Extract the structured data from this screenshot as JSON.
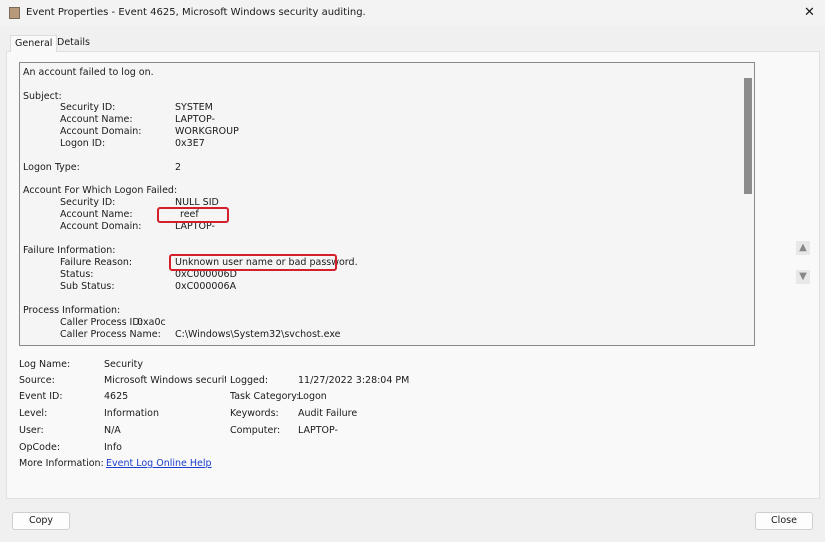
{
  "window": {
    "title": "Event Properties - Event 4625, Microsoft Windows security auditing.",
    "close": "✕"
  },
  "tabs": [
    {
      "label": "General"
    },
    {
      "label": "Details"
    }
  ],
  "description": [
    {
      "text": "An account failed to log on.",
      "indent": 0
    },
    {
      "text": "Subject:",
      "indent": 0
    },
    {
      "label": "Security ID:",
      "value": "SYSTEM"
    },
    {
      "label": "Account Name:",
      "value": "LAPTOP-"
    },
    {
      "label": "Account Domain:",
      "value": "WORKGROUP"
    },
    {
      "label": "Logon ID:",
      "value": "0x3E7"
    },
    {
      "label0": "Logon Type:",
      "value": "2"
    },
    {
      "text": "Account For Which Logon Failed:"
    },
    {
      "label": "Security ID:",
      "value": "NULL SID"
    },
    {
      "label": "Account Name:",
      "value": "reef"
    },
    {
      "label": "Account Domain:",
      "value": "LAPTOP-"
    },
    {
      "text": "Failure Information:"
    },
    {
      "label": "Failure Reason:",
      "value": "Unknown user name or bad password."
    },
    {
      "label": "Status:",
      "value": "0xC000006D"
    },
    {
      "label": "Sub Status:",
      "value": "0xC000006A"
    },
    {
      "text": "Process Information:"
    },
    {
      "label": "Caller Process ID:",
      "value": "0xa0c"
    },
    {
      "label": "Caller Process Name:",
      "value": "C:\\Windows\\System32\\svchost.exe"
    }
  ],
  "fields": {
    "log_name": {
      "label": "Log Name:",
      "value": "Security"
    },
    "source": {
      "label": "Source:",
      "value": "Microsoft Windows security :"
    },
    "event_id": {
      "label": "Event ID:",
      "value": "4625"
    },
    "level": {
      "label": "Level:",
      "value": "Information"
    },
    "user": {
      "label": "User:",
      "value": "N/A"
    },
    "opcode": {
      "label": "OpCode:",
      "value": "Info"
    },
    "more_info": {
      "label": "More Information:",
      "value": "Event Log Online Help"
    },
    "logged": {
      "label": "Logged:",
      "value": "11/27/2022 3:28:04 PM"
    },
    "task_category": {
      "label": "Task Category:",
      "value": "Logon"
    },
    "keywords": {
      "label": "Keywords:",
      "value": "Audit Failure"
    },
    "computer": {
      "label": "Computer:",
      "value": "LAPTOP-"
    }
  },
  "buttons": {
    "copy": "Copy",
    "close": "Close"
  },
  "icons": {
    "up": "arrow-up-icon",
    "down": "arrow-down-icon"
  },
  "colors": {
    "highlight": "#d4202a",
    "link": "#1a3ccc"
  }
}
